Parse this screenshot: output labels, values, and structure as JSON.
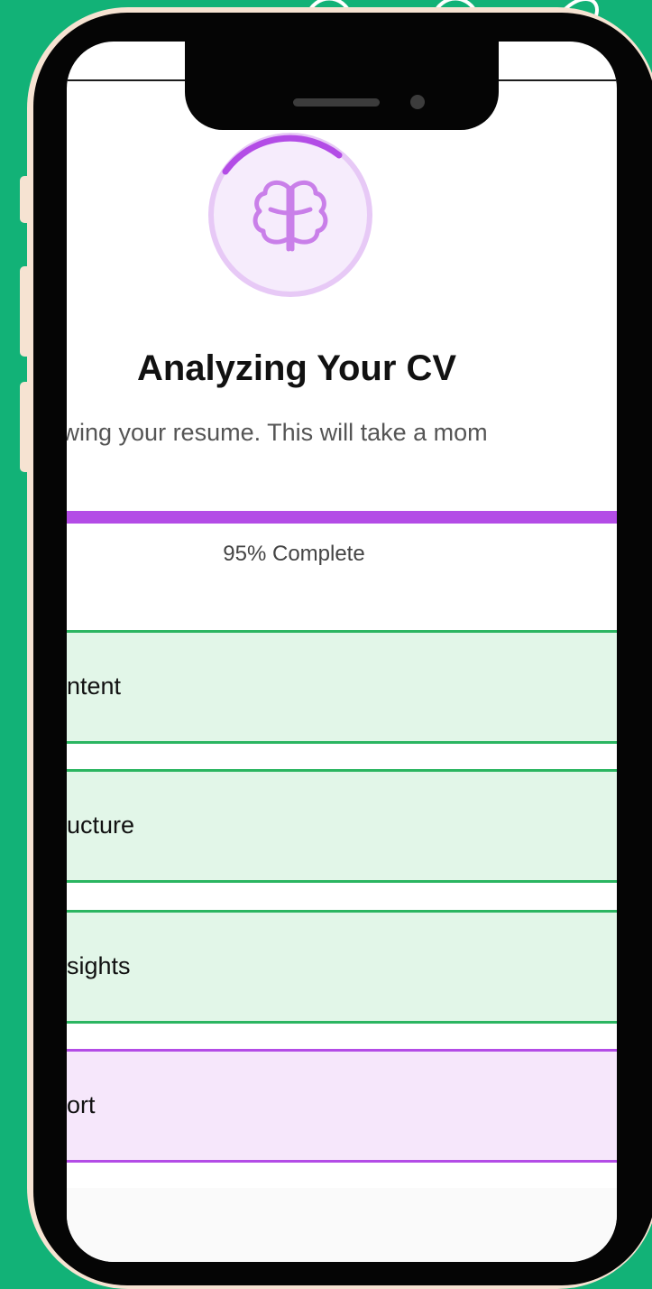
{
  "screen": {
    "title": "Analyzing Your CV",
    "subtitle": "viewing your resume. This will take a mom",
    "progress": {
      "percent": 95,
      "label": "95% Complete"
    },
    "steps": [
      {
        "label": "ntent",
        "status": "done"
      },
      {
        "label": "ucture",
        "status": "done"
      },
      {
        "label": "sights",
        "status": "done"
      },
      {
        "label": "ort",
        "status": "active"
      },
      {
        "label": "",
        "status": "pending"
      }
    ],
    "icon": "brain-icon"
  },
  "colors": {
    "background": "#12b277",
    "accent": "#b34ce6",
    "done_border": "#2bb561",
    "done_fill": "#e2f6e8",
    "active_fill": "#f6e7fb",
    "pending_border": "#e7c233"
  }
}
